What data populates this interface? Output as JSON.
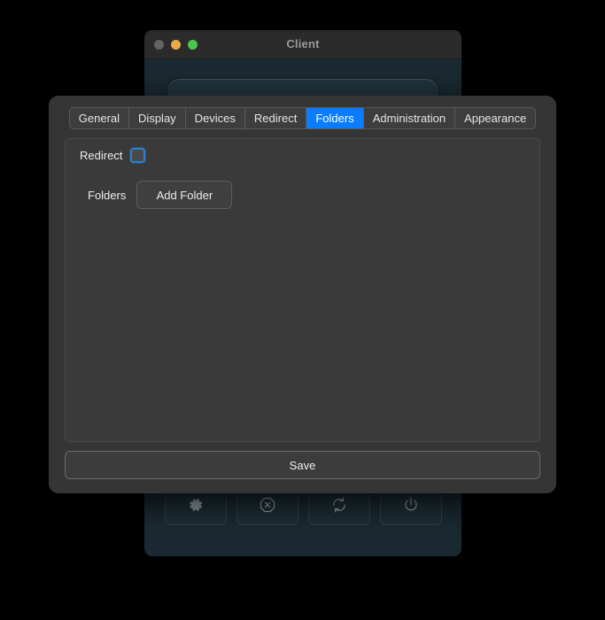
{
  "background_window": {
    "title": "Client",
    "traffic_lights": [
      {
        "name": "close",
        "color": "#636363"
      },
      {
        "name": "minimize",
        "color": "#e8aa47"
      },
      {
        "name": "maximize",
        "color": "#4cc54c"
      }
    ],
    "toolbar_buttons": [
      {
        "icon": "gear-icon",
        "label": "Settings"
      },
      {
        "icon": "cancel-octagon-icon",
        "label": "Disconnect"
      },
      {
        "icon": "refresh-icon",
        "label": "Reconnect"
      },
      {
        "icon": "power-icon",
        "label": "Power"
      }
    ]
  },
  "dialog": {
    "tabs": [
      {
        "label": "General",
        "active": false
      },
      {
        "label": "Display",
        "active": false
      },
      {
        "label": "Devices",
        "active": false
      },
      {
        "label": "Redirect",
        "active": false
      },
      {
        "label": "Folders",
        "active": true
      },
      {
        "label": "Administration",
        "active": false
      },
      {
        "label": "Appearance",
        "active": false
      }
    ],
    "fields": {
      "redirect_label": "Redirect",
      "redirect_checked": false,
      "folders_label": "Folders",
      "add_folder_label": "Add Folder"
    },
    "save_label": "Save"
  },
  "colors": {
    "accent": "#0a7cff",
    "focus_ring": "#2b7fd0",
    "dialog_bg": "#353535",
    "panel_bg": "#3a3a3a",
    "window_bg": "#1b2a32",
    "titlebar_bg": "#2b2b2b"
  }
}
